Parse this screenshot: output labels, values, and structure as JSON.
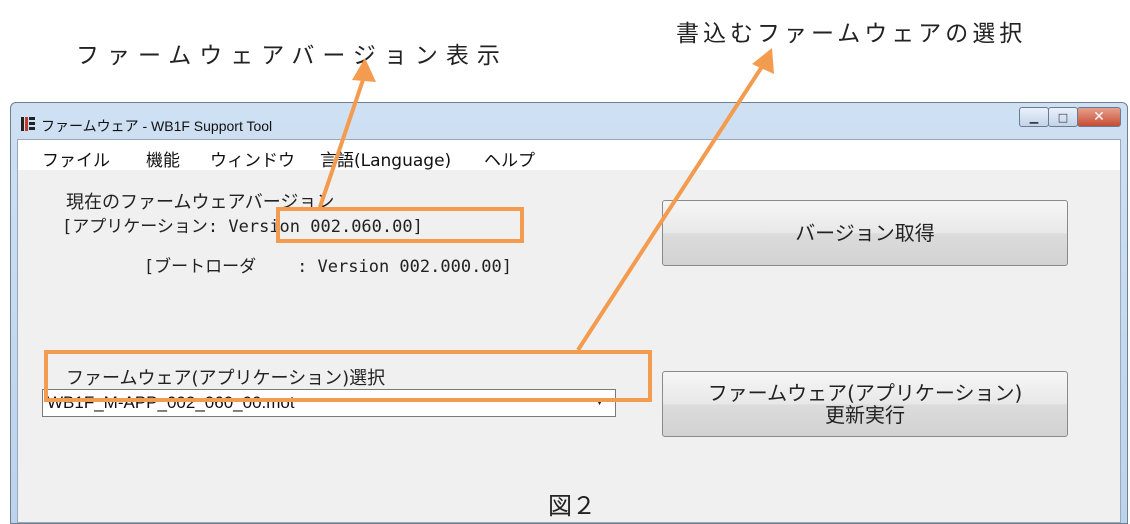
{
  "callouts": {
    "version_display": "ファームウェアバージョン表示",
    "firmware_select": "書込むファームウェアの選択"
  },
  "window": {
    "title": "ファームウェア - WB1F Support Tool",
    "buttons": {
      "minimize": "▁",
      "maximize": "□",
      "close": "✕"
    }
  },
  "menubar": [
    "ファイル",
    "機能",
    "ウィンドウ",
    "言語(Language)",
    "ヘルプ"
  ],
  "firmware": {
    "current_heading": "現在のファームウェアバージョン",
    "app_label": "[アプリケーション: ",
    "app_version": "Version 002.060.00]",
    "boot_label": "[ブートローダ    : ",
    "boot_version": "Version 002.000.00]",
    "get_version_button": "バージョン取得",
    "select_heading": "ファームウェア(アプリケーション)選択",
    "selected_file": "WB1F_M-APP_002_060_00.mot",
    "update_button_line1": "ファームウェア(アプリケーション)",
    "update_button_line2": "更新実行"
  },
  "figure_label": "図２",
  "colors": {
    "highlight": "#f39b4e",
    "titlebar": "#c7dbf1",
    "close_button": "#c54d34"
  }
}
